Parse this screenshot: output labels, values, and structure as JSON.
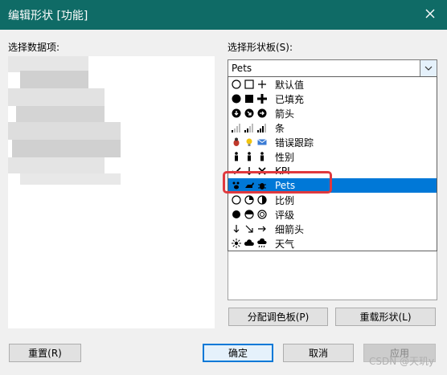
{
  "window": {
    "title": "编辑形状 [功能]"
  },
  "left": {
    "label": "选择数据项:"
  },
  "right": {
    "label": "选择形状板(S):",
    "combo_value": "Pets",
    "options": [
      {
        "label": "默认值",
        "icons": [
          "circle-outline-icon",
          "square-outline-icon",
          "plus-icon"
        ]
      },
      {
        "label": "已填充",
        "icons": [
          "circle-filled-icon",
          "square-filled-icon",
          "plus-bold-icon"
        ]
      },
      {
        "label": "箭头",
        "icons": [
          "arrow-down-circle-icon",
          "arrow-diag-circle-icon",
          "arrow-right-circle-icon"
        ]
      },
      {
        "label": "条",
        "icons": [
          "bars-1-icon",
          "bars-2-icon",
          "bars-3-icon"
        ]
      },
      {
        "label": "错误跟踪",
        "icons": [
          "bug-icon",
          "bulb-icon",
          "mail-icon"
        ]
      },
      {
        "label": "性别",
        "icons": [
          "person-icon",
          "person-icon",
          "person-icon"
        ]
      },
      {
        "label": "KPI",
        "icons": [
          "check-icon",
          "arrow-down-icon",
          "x-icon"
        ]
      },
      {
        "label": "Pets",
        "icons": [
          "paw-icon",
          "dog-icon",
          "bug-icon"
        ],
        "selected": true
      },
      {
        "label": "比例",
        "icons": [
          "circle-outline-icon",
          "circle-quarter-icon",
          "circle-half-icon"
        ]
      },
      {
        "label": "评级",
        "icons": [
          "circle-filled-icon",
          "circle-half-h-icon",
          "circle-ring-icon"
        ]
      },
      {
        "label": "细箭头",
        "icons": [
          "arrow-down-icon",
          "arrow-diag-icon",
          "arrow-right-icon"
        ]
      },
      {
        "label": "天气",
        "icons": [
          "sun-icon",
          "cloud-icon",
          "rain-icon"
        ]
      }
    ]
  },
  "buttons": {
    "assign_palette": "分配调色板(P)",
    "reload_shapes": "重载形状(L)",
    "reset": "重置(R)",
    "ok": "确定",
    "cancel": "取消",
    "apply": "应用"
  },
  "watermark": "CSDN @天玑y"
}
